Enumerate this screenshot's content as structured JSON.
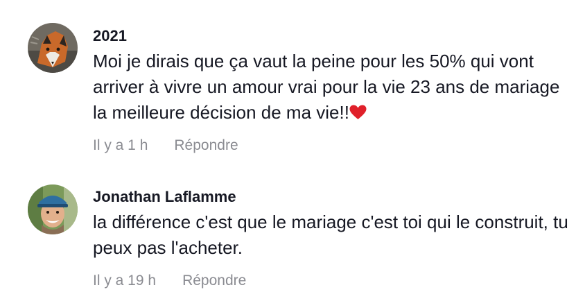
{
  "comments": [
    {
      "username": "2021",
      "text": "Moi je dirais que ça vaut la peine pour les 50% qui vont arriver à vivre un amour vrai pour la vie 23 ans de mariage la meilleure décision de ma vie!!",
      "emoji": "❤️",
      "emoji_icon": "red-heart-icon",
      "time": "Il y a 1 h",
      "reply_label": "Répondre",
      "avatar_icon": "fox-avatar"
    },
    {
      "username": "Jonathan Laflamme",
      "text": "la différence c'est que le mariage c'est toi qui le construit, tu peux pas l'acheter.",
      "time": "Il y a 19 h",
      "reply_label": "Répondre",
      "avatar_icon": "man-with-cap-avatar"
    }
  ],
  "colors": {
    "text": "#161823",
    "muted": "#8a8b91",
    "heart": "#e0202a"
  }
}
